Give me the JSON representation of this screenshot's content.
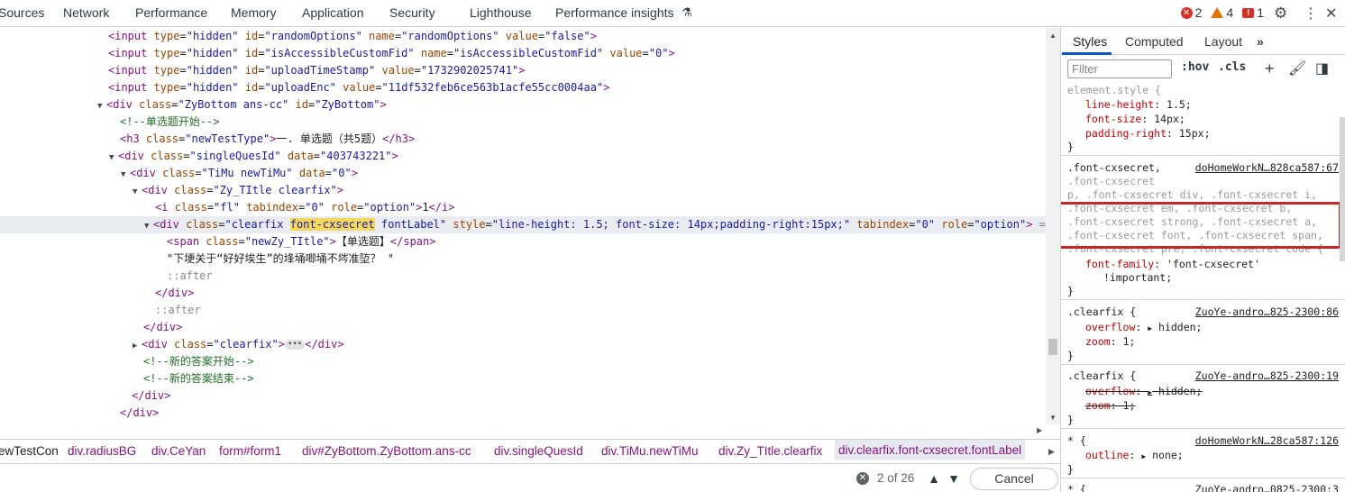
{
  "top_tabs": [
    "Sources",
    "Network",
    "Performance",
    "Memory",
    "Application",
    "Security",
    "Lighthouse",
    "Performance insights"
  ],
  "counts": {
    "errors": "2",
    "warnings": "4",
    "issues": "1"
  },
  "icons": {
    "flask": "flask-icon",
    "settings": "gear-icon",
    "menu": "kebab-menu-icon",
    "close": "close-icon"
  },
  "dom": {
    "l1": {
      "tag_open": "<input ",
      "a1": "type",
      "v1": "\"hidden\"",
      "a2": "id",
      "v2": "\"randomOptions\"",
      "a3": "name",
      "v3": "\"randomOptions\"",
      "a4": "value",
      "v4": "\"false\"",
      "close": ">"
    },
    "l2": {
      "tag_open": "<input ",
      "a1": "type",
      "v1": "\"hidden\"",
      "a2": "id",
      "v2": "\"isAccessibleCustomFid\"",
      "a3": "name",
      "v3": "\"isAccessibleCustomFid\"",
      "a4": "value",
      "v4": "\"0\"",
      "close": ">"
    },
    "l3": {
      "tag_open": "<input ",
      "a1": "type",
      "v1": "\"hidden\"",
      "a2": "id",
      "v2": "\"uploadTimeStamp\"",
      "a3": "value",
      "v3": "\"1732902025741\"",
      "close": ">"
    },
    "l4": {
      "tag_open": "<input ",
      "a1": "type",
      "v1": "\"hidden\"",
      "a2": "id",
      "v2": "\"uploadEnc\"",
      "a3": "value",
      "v3": "\"11df532feb6ce563b1acfe55cc0004aa\"",
      "close": ">"
    },
    "l5": {
      "tag_open": "<div ",
      "a1": "class",
      "v1": "\"ZyBottom ans-cc\"",
      "a2": "id",
      "v2": "\"ZyBottom\"",
      "close": ">"
    },
    "l6": {
      "comment": "<!--单选题开始-->"
    },
    "l7": {
      "tag_open": "<h3 ",
      "a1": "class",
      "v1": "\"newTestType\"",
      "close": ">",
      "text": "一. 单选题（共5题）",
      "end": "</h3>"
    },
    "l8": {
      "tag_open": "<div ",
      "a1": "class",
      "v1": "\"singleQuesId\"",
      "a2": "data",
      "v2": "\"403743221\"",
      "close": ">"
    },
    "l9": {
      "tag_open": "<div ",
      "a1": "class",
      "v1": "\"TiMu newTiMu\"",
      "a2": "data",
      "v2": "\"0\"",
      "close": ">"
    },
    "l10": {
      "tag_open": "<div ",
      "a1": "class",
      "v1": "\"Zy_TItle clearfix\"",
      "close": ">"
    },
    "l11": {
      "tag_open": "<i ",
      "a1": "class",
      "v1": "\"fl\"",
      "a2": "tabindex",
      "v2": "\"0\"",
      "a3": "role",
      "v3": "\"option\"",
      "close": ">",
      "text": "1",
      "end": "</i>"
    },
    "l12": {
      "tag_open": "<div ",
      "a1": "class",
      "v1_a": "\"clearfix ",
      "v1_hl": "font-cxsecret",
      "v1_b": " fontLabel\"",
      "a2": "style",
      "v2": "\"line-height: 1.5; font-size: 14px;padding-right:15px;\"",
      "a3": "tabindex",
      "v3": "\"0\"",
      "a4": "role",
      "v4": "\"option\"",
      "close": ">",
      "eq": " == $0"
    },
    "l13": {
      "tag_open": "<span ",
      "a1": "class",
      "v1": "\"newZy_TItle\"",
      "close": ">",
      "text": "【单选题】",
      "end": "</span>"
    },
    "l14": {
      "text": "\"下埂关于“好好埃生”的埄埇唧埇不埁准埅？ \""
    },
    "l15": {
      "pseudo": "::after"
    },
    "l16": {
      "end": "</div>"
    },
    "l17": {
      "pseudo": "::after"
    },
    "l18": {
      "end": "</div>"
    },
    "l19": {
      "tag_open": "<div ",
      "a1": "class",
      "v1": "\"clearfix\"",
      "close": ">",
      "ellipsis": "•••",
      "end": "</div>"
    },
    "l20": {
      "comment": "<!--新的答案开始-->"
    },
    "l21": {
      "comment": "<!--新的答案结束-->"
    },
    "l22": {
      "end": "</div>"
    },
    "l23": {
      "end": "</div>"
    }
  },
  "breadcrumbs": [
    {
      "tag": "ewTestCon",
      "rest": ""
    },
    {
      "tag": "div",
      "rest": ".radiusBG"
    },
    {
      "tag": "div",
      "rest": ".CeYan"
    },
    {
      "tag": "form",
      "rest": "#form1"
    },
    {
      "tag": "div",
      "rest": "#ZyBottom.ZyBottom.ans-cc"
    },
    {
      "tag": "div",
      "rest": ".singleQuesId"
    },
    {
      "tag": "div",
      "rest": ".TiMu.newTiMu"
    },
    {
      "tag": "div",
      "rest": ".Zy_TItle.clearfix"
    },
    {
      "tag": "div",
      "rest": ".clearfix.font-cxsecret.fontLabel"
    }
  ],
  "search": {
    "match_count": "2 of 26",
    "cancel_label": "Cancel"
  },
  "styles_pane": {
    "tabs": [
      "Styles",
      "Computed",
      "Layout"
    ],
    "filter_placeholder": "Filter",
    "hov": ":hov",
    "cls": ".cls",
    "rule1": {
      "selector": "element.style {",
      "p1": "line-height",
      "v1": "1.5;",
      "p2": "font-size",
      "v2": "14px;",
      "p3": "padding-right",
      "v3": "15px;",
      "close": "}"
    },
    "rule2": {
      "selector": ".font-cxsecret,",
      "source": "doHomeWorkN…828ca587:67",
      "sel_lines": [
        ".font-cxsecret",
        "p, .font-cxsecret div, .font-cxsecret i,",
        ".font-cxsecret em, .font-cxsecret b,",
        ".font-cxsecret strong, .font-cxsecret a,",
        ".font-cxsecret font, .font-cxsecret span,",
        ".font-cxsecret pre, .font-cxsecret code {"
      ],
      "p1": "font-family",
      "v1": "'font-cxsecret'",
      "important": "!important;",
      "close": "}"
    },
    "rule3": {
      "selector": ".clearfix {",
      "source": "ZuoYe-andro…825-2300:86",
      "p1": "overflow",
      "v1": "hidden;",
      "p2": "zoom",
      "v2": "1;",
      "close": "}"
    },
    "rule4": {
      "selector": ".clearfix {",
      "source": "ZuoYe-andro…825-2300:19",
      "p1": "overflow",
      "v1": "hidden;",
      "p2": "zoom",
      "v2": "1;",
      "close": "}"
    },
    "rule5": {
      "selector": "* {",
      "source": "doHomeWorkN…28ca587:126",
      "p1": "outline",
      "v1": "none;",
      "close": "}"
    },
    "rule6": {
      "selector": "* {",
      "source": "ZuoYe-andro…0825-2300:3"
    }
  }
}
